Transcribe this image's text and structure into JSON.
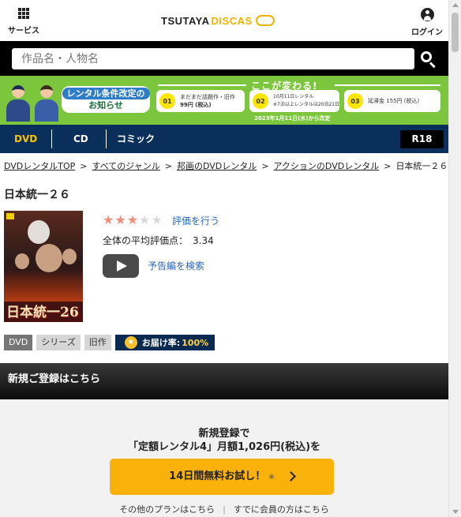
{
  "header": {
    "services_label": "サービス",
    "logo_part1": "TSUTAYA",
    "logo_part2": "DISCAS",
    "login_label": "ログイン"
  },
  "search": {
    "placeholder": "作品名・人物名"
  },
  "banner": {
    "tag_line1": "レンタル条件改定の",
    "tag_line2": "お知らせ",
    "heading": "ここが変わる!",
    "items": [
      {
        "num": "01",
        "line1": "まだまだ話題作・旧作",
        "line2": "99円 (税込)"
      },
      {
        "num": "02",
        "line1": "10月11日レンタル",
        "line2": "※7泊以上レンタルは20泊21日"
      },
      {
        "num": "03",
        "line1": "延滞金 155円 (税込)",
        "line2": ""
      }
    ],
    "date": "2023年1月11日(水)から改定"
  },
  "categories": {
    "items": [
      "DVD",
      "CD",
      "コミック"
    ],
    "active": "DVD",
    "r18": "R18"
  },
  "breadcrumb": {
    "items": [
      "DVDレンタルTOP",
      "すべてのジャンル",
      "邦画のDVDレンタル",
      "アクションのDVDレンタル"
    ],
    "current": "日本統一２６",
    "separator": ">"
  },
  "product": {
    "title": "日本統一２６",
    "poster_title": "日本統一26",
    "rating_stars": 3,
    "rating_max": 5,
    "rate_link": "評価を行う",
    "avg_label": "全体の平均評価点：",
    "avg_value": "3.34",
    "trailer_link": "予告編を検索",
    "tags": [
      "DVD",
      "シリーズ",
      "旧作"
    ],
    "delivery_label": "お届け率:",
    "delivery_rate": "100%"
  },
  "register": {
    "heading": "新規ご登録はこちら",
    "line1": "新規登録で",
    "line2": "「定額レンタル4」月額1,026円(税込)を",
    "cta_label": "14日間無料お試し！",
    "cta_mark": "※",
    "link_other_plans": "その他のプランはこちら",
    "link_members": "すでに会員の方はこちら"
  },
  "colors": {
    "nav_bg": "#0a2f5b",
    "active_category": "#ffc400",
    "banner_bg": "#7bc63d",
    "cta_bg": "#fab20a",
    "link": "#2a66b8",
    "star_on": "#f08c78"
  }
}
